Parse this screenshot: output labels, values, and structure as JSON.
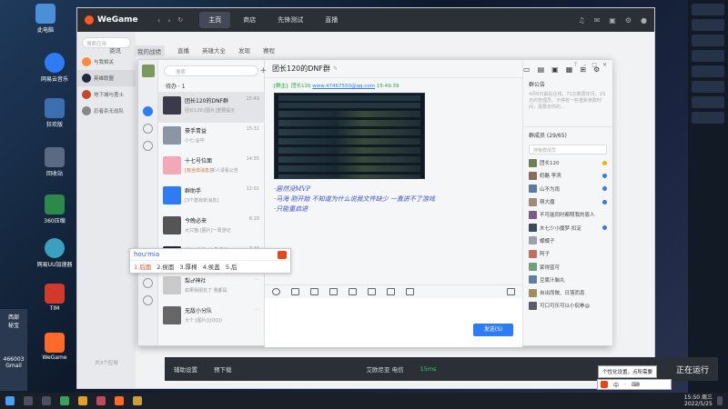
{
  "desktop": {
    "icons": [
      {
        "label": "此电脑"
      },
      {
        "label": "网易云音乐"
      },
      {
        "label": "狂欢版"
      },
      {
        "label": "回收站"
      },
      {
        "label": "360压缩"
      },
      {
        "label": "网易UU加速器"
      },
      {
        "label": "TIM"
      },
      {
        "label": "WeGame"
      }
    ],
    "banner": {
      "line1": "西部",
      "line2": "秘宝",
      "line3": "466003",
      "line4": "Gmail"
    }
  },
  "wegame": {
    "logo": "WeGame",
    "nav": [
      {
        "label": "主页",
        "active": true
      },
      {
        "label": "商店",
        "active": false
      },
      {
        "label": "先锋测试",
        "active": false
      },
      {
        "label": "直播",
        "active": false
      }
    ],
    "sidebar": {
      "search_placeholder": "搜索应用",
      "items": [
        {
          "label": "与我相关"
        },
        {
          "label": "英雄联盟"
        },
        {
          "label": "地下城与勇士"
        },
        {
          "label": "忍者杀无战队"
        }
      ],
      "footer": "共3个应用"
    },
    "tabs": [
      {
        "label": "资讯",
        "active": false
      },
      {
        "label": "我的战绩",
        "active": true
      },
      {
        "label": "直播",
        "active": false
      },
      {
        "label": "英雄大全",
        "active": false
      },
      {
        "label": "发现",
        "active": false
      },
      {
        "label": "赛程",
        "active": false
      }
    ],
    "bottom_bar": {
      "assist": "辅助设置",
      "download": "预下载",
      "region": "艾欧尼亚 电信",
      "ping": "15ms",
      "start": "正在运行"
    }
  },
  "chat": {
    "search_placeholder": "搜索",
    "todo": "待办 · 1",
    "conversations": [
      {
        "name": "团长120的DNF群",
        "preview": "团长120:[图片]重要提示",
        "time": "15:49",
        "highlight": "",
        "color": "#3a3a4a"
      },
      {
        "name": "豪手青益",
        "preview": "小七:@中",
        "time": "15:31",
        "highlight": "",
        "color": "#8a95a5"
      },
      {
        "name": "十七号位面",
        "preview": "[有全体消息]新人请看公告",
        "time": "14:55",
        "highlight": "[有全体消息]",
        "color": "#f2a8b8"
      },
      {
        "name": "群助手",
        "preview": "[3个群有新消息]",
        "time": "12:01",
        "highlight": "",
        "color": "#2d7cf6"
      },
      {
        "name": "今晚必来",
        "preview": "大只猫:[图片]一周游记",
        "time": "8:18",
        "highlight": "",
        "color": "#555"
      },
      {
        "name": "英年英雄联盟手游",
        "preview": "[有全体消息]新版本",
        "time": "7:46",
        "highlight": "[有全体消息]",
        "color": "#1d2a3c"
      },
      {
        "name": "梨♂神社",
        "preview": "如果我朋友了 我都是",
        "time": "...",
        "highlight": "",
        "color": "#c9c9c9"
      },
      {
        "name": "无敌小分队",
        "preview": "大个:[图片]([QQ])",
        "time": "...",
        "highlight": "",
        "color": "#666"
      }
    ],
    "group_title": "团长120的DNF群",
    "message_meta": {
      "tag": "[群主]",
      "sender": "团长120",
      "link": "www.47467550@qq.com",
      "time": "15:49:39"
    },
    "messages": [
      "·居然没MVP",
      "·马海 刚开始 不知道为什么说我文件缺少 一直进不了游戏",
      "·只能重启进"
    ],
    "ime": {
      "pinyin": "hou'mia",
      "candidates": [
        "1.后面",
        "2.侯面",
        "3.厚棉",
        "4.侯盖",
        "5.后"
      ]
    },
    "send_label": "发送(S)",
    "notice_title": "群公告",
    "notice_text": "4月6日最后在线，71次数限定月。23日的管理员，不停有一些重新参群时间，需要去你的…",
    "members_title": "群成员 (29/65)",
    "members_search": "搜索群成员",
    "members": [
      {
        "name": "团长120",
        "role": "owner",
        "color": "#6a7f5a"
      },
      {
        "name": "奶酪  李滨",
        "role": "admin",
        "color": "#8a6a5a"
      },
      {
        "name": "山不为雨",
        "role": "admin",
        "color": "#5a7aa0"
      },
      {
        "name": "萌大魔",
        "role": "admin",
        "color": "#a08a7a"
      },
      {
        "name": "不可能同时都照我的恩人",
        "role": "",
        "color": "#7a5a8a"
      },
      {
        "name": "木七少小魔梦·扣淀",
        "role": "admin",
        "color": "#3a4a5a"
      },
      {
        "name": "蝶蝶子",
        "role": "",
        "color": "#9aa0b0"
      },
      {
        "name": "阿子",
        "role": "",
        "color": "#c07060"
      },
      {
        "name": "家得蓝可",
        "role": "",
        "color": "#70a080"
      },
      {
        "name": "豆腐汁脑丸",
        "role": "",
        "color": "#6080a0"
      },
      {
        "name": "自出而做、日落而息",
        "role": "",
        "color": "#a09060"
      },
      {
        "name": "可口可乐可以小侃拳@",
        "role": "",
        "color": "#5a5a6a"
      }
    ]
  },
  "taskbar": {
    "time": "15:50 周三",
    "date": "2022/5/25",
    "tooltip": "个性化设置，点所需要"
  }
}
